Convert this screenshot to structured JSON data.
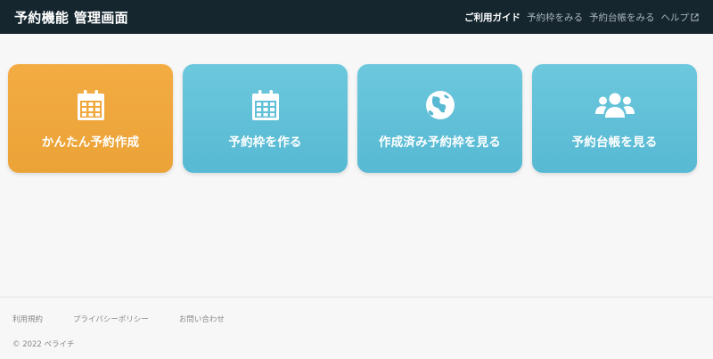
{
  "header": {
    "title": "予約機能 管理画面",
    "nav": [
      {
        "label": "ご利用ガイド",
        "active": true
      },
      {
        "label": "予約枠をみる",
        "active": false
      },
      {
        "label": "予約台帳をみる",
        "active": false
      },
      {
        "label": "ヘルプ",
        "active": false,
        "icon": "external-link-icon"
      }
    ]
  },
  "cards": [
    {
      "label": "かんたん予約作成",
      "icon": "calendar-icon",
      "color": "#f0a83d"
    },
    {
      "label": "予約枠を作る",
      "icon": "calendar-icon",
      "color": "#62c0d8"
    },
    {
      "label": "作成済み予約枠を見る",
      "icon": "globe-icon",
      "color": "#62c0d8"
    },
    {
      "label": "予約台帳を見る",
      "icon": "users-icon",
      "color": "#62c0d8"
    }
  ],
  "footer": {
    "links": [
      "利用規約",
      "プライバシーポリシー",
      "お問い合わせ"
    ],
    "copyright": "© 2022 ペライチ"
  },
  "colors": {
    "header_bg": "#15262f",
    "accent_orange": "#f0a83d",
    "accent_blue": "#62c0d8",
    "page_bg": "#f7f7f7"
  }
}
